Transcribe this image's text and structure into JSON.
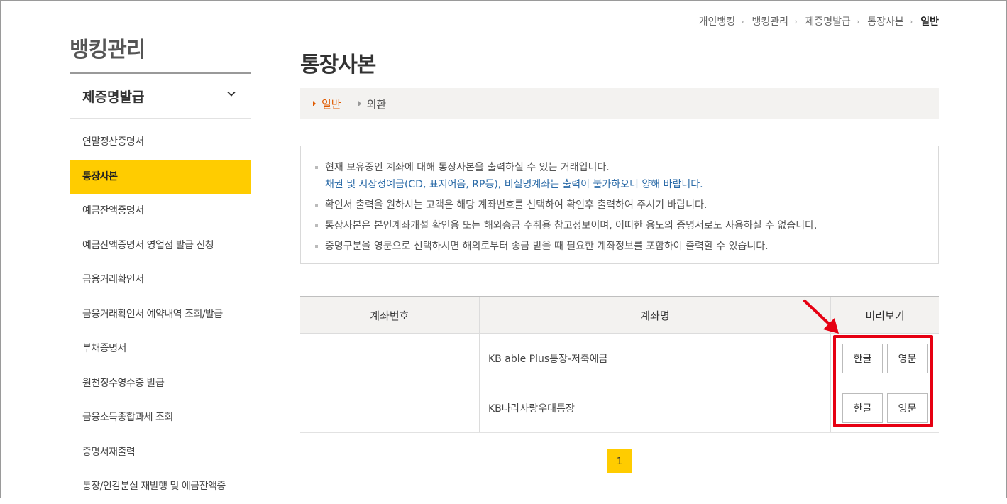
{
  "breadcrumb": [
    "개인뱅킹",
    "뱅킹관리",
    "제증명발급",
    "통장사본",
    "일반"
  ],
  "sidebar": {
    "title": "뱅킹관리",
    "section": "제증명발급",
    "items": [
      {
        "label": "연말정산증명서"
      },
      {
        "label": "통장사본"
      },
      {
        "label": "예금잔액증명서"
      },
      {
        "label": "예금잔액증명서 영업점 발급 신청"
      },
      {
        "label": "금융거래확인서"
      },
      {
        "label": "금융거래확인서 예약내역 조회/발급"
      },
      {
        "label": "부채증명서"
      },
      {
        "label": "원천징수영수증 발급"
      },
      {
        "label": "금융소득종합과세 조회"
      },
      {
        "label": "증명서재출력"
      },
      {
        "label": "통장/인감분실 재발행 및 예금잔액증"
      }
    ],
    "active_index": 1
  },
  "main": {
    "title": "통장사본",
    "tabs": [
      {
        "label": "일반"
      },
      {
        "label": "외환"
      }
    ],
    "notice": {
      "line1": "현재 보유중인 계좌에 대해 통장사본을 출력하실 수 있는 거래입니다.",
      "line1_sub": "채권 및 시장성예금(CD, 표지어음, RP등), 비실명계좌는 출력이 불가하오니 양해 바랍니다.",
      "line2": "확인서 출력을 원하시는 고객은 해당 계좌번호를 선택하여 확인후 출력하여 주시기 바랍니다.",
      "line3": "통장사본은 본인계좌개설 확인용 또는 해외송금 수취용 참고정보이며, 어떠한 용도의 증명서로도 사용하실 수 없습니다.",
      "line4": "증명구분을 영문으로 선택하시면 해외로부터 송금 받을 때 필요한 계좌정보를 포함하여 출력할 수 있습니다."
    },
    "table": {
      "headers": {
        "account_no": "계좌번호",
        "account_name": "계좌명",
        "preview": "미리보기"
      },
      "rows": [
        {
          "account_no": "",
          "account_name": "KB able Plus통장-저축예금",
          "btn_korean": "한글",
          "btn_english": "영문"
        },
        {
          "account_no": "",
          "account_name": "KB나라사랑우대통장",
          "btn_korean": "한글",
          "btn_english": "영문"
        }
      ]
    },
    "pagination": {
      "current": "1"
    }
  },
  "colors": {
    "accent": "#ffcc00",
    "active_tab": "#e05a00",
    "highlight": "#e60012",
    "notice_link": "#2a6aa7"
  }
}
